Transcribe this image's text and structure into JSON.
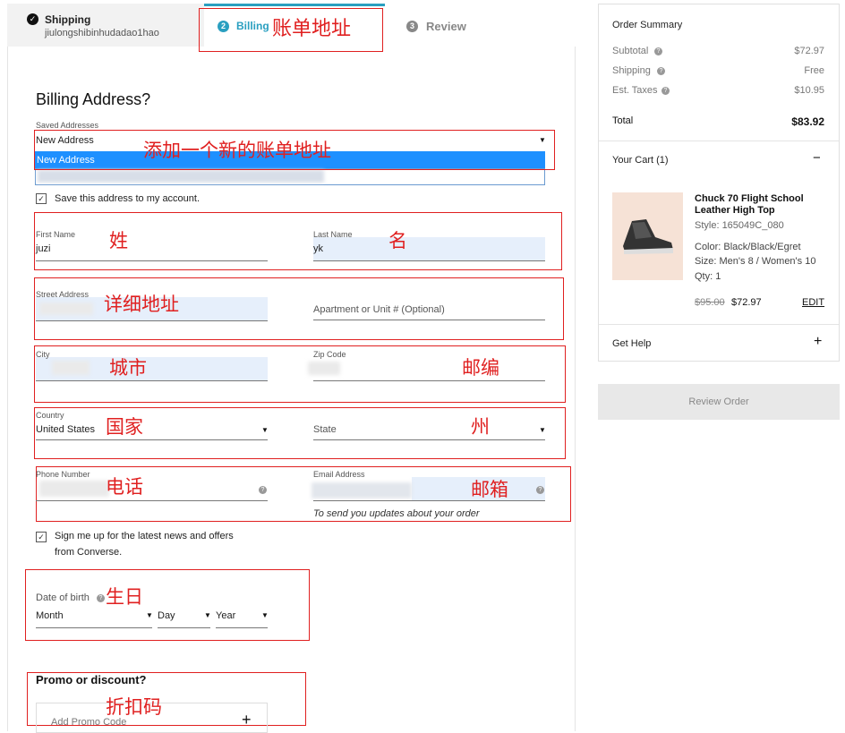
{
  "tabs": {
    "shipping": {
      "title": "Shipping",
      "subtitle": "jiulongshibinhudadao1hao",
      "check": "✓"
    },
    "billing": {
      "num": "2",
      "label": "Billing",
      "annotation": "账单地址"
    },
    "review": {
      "num": "3",
      "label": "Review"
    }
  },
  "colors": {
    "accent": "#2a9fc0",
    "annotation": "#e02020",
    "select_highlight": "#1e90ff"
  },
  "billing": {
    "title": "Billing Address?",
    "saved_label": "Saved Addresses",
    "saved_value": "New Address",
    "saved_option": "New Address",
    "saved_annotation": "添加一个新的账单地址",
    "save_account_label": "Save this address to my account.",
    "first_name_label": "First Name",
    "first_name_value": "juzi",
    "first_name_annotation": "姓",
    "last_name_label": "Last Name",
    "last_name_value": "yk",
    "last_name_annotation": "名",
    "street_label": "Street Address",
    "street_annotation": "详细地址",
    "apartment_placeholder": "Apartment or Unit # (Optional)",
    "city_label": "City",
    "city_annotation": "城市",
    "zip_label": "Zip Code",
    "zip_annotation": "邮编",
    "country_label": "Country",
    "country_value": "United States",
    "country_annotation": "国家",
    "state_placeholder": "State",
    "state_annotation": "州",
    "phone_label": "Phone Number",
    "phone_annotation": "电话",
    "email_label": "Email Address",
    "email_annotation": "邮箱",
    "email_note": "To send you updates about your order",
    "newsletter_label_1": "Sign me up for the latest news and offers",
    "newsletter_label_2": "from Converse.",
    "dob_label": "Date of birth",
    "dob_annotation": "生日",
    "dob_month": "Month",
    "dob_day": "Day",
    "dob_year": "Year",
    "promo_title": "Promo or discount?",
    "promo_annotation": "折扣码",
    "promo_placeholder": "Add Promo Code",
    "promo_plus": "+"
  },
  "summary": {
    "title": "Order Summary",
    "subtotal_label": "Subtotal",
    "subtotal_value": "$72.97",
    "shipping_label": "Shipping",
    "shipping_value": "Free",
    "taxes_label": "Est. Taxes",
    "taxes_value": "$10.95",
    "total_label": "Total",
    "total_value": "$83.92",
    "cart_label": "Your Cart (1)",
    "cart_toggle": "−",
    "product_name_1": "Chuck 70 Flight School",
    "product_name_2": "Leather High Top",
    "style": "Style: 165049C_080",
    "color": "Color: Black/Black/Egret",
    "size": "Size: Men's 8 / Women's 10",
    "qty": "Qty: 1",
    "old_price": "$95.00",
    "price": "$72.97",
    "edit": "EDIT",
    "help_label": "Get Help",
    "help_toggle": "+"
  },
  "review_button": "Review Order"
}
